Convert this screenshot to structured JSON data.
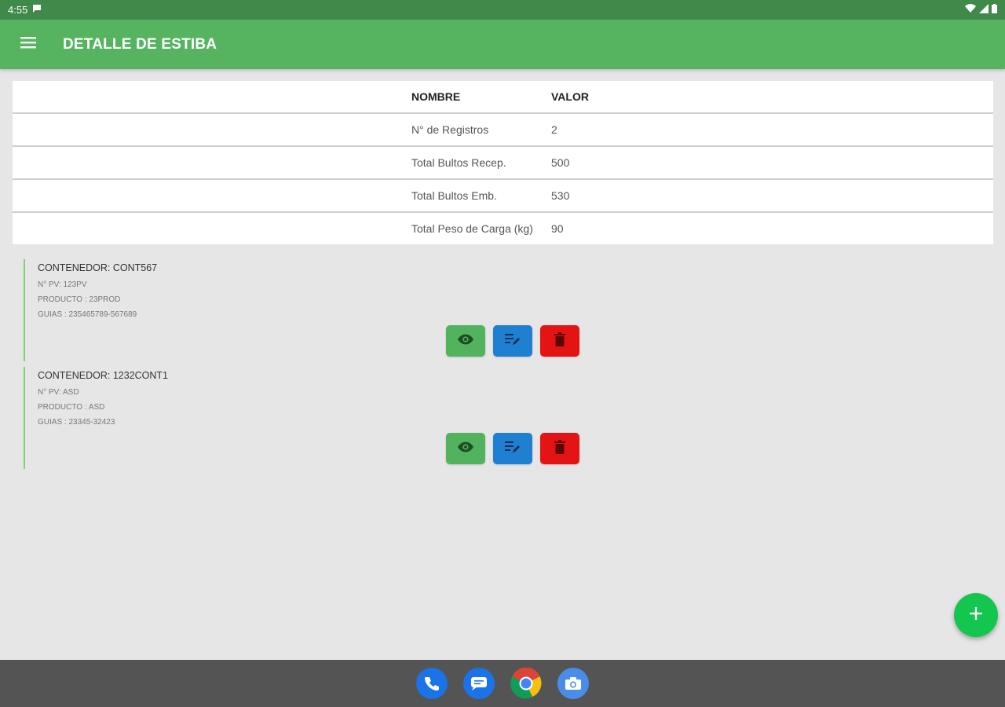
{
  "status_bar": {
    "time": "4:55"
  },
  "app_bar": {
    "title": "DETALLE DE ESTIBA"
  },
  "summary": {
    "header": {
      "name": "NOMBRE",
      "value": "VALOR"
    },
    "rows": [
      {
        "name": "N° de Registros",
        "value": "2"
      },
      {
        "name": "Total Bultos Recep.",
        "value": "500"
      },
      {
        "name": "Total Bultos Emb.",
        "value": "530"
      },
      {
        "name": "Total Peso de Carga (kg)",
        "value": "90"
      }
    ]
  },
  "records": [
    {
      "title": "CONTENEDOR: CONT567",
      "pv": "N° PV: 123PV",
      "producto": "PRODUCTO : 23PROD",
      "guias": "GUIAS : 235465789-567689"
    },
    {
      "title": "CONTENEDOR: 1232CONT1",
      "pv": "N° PV: ASD",
      "producto": "PRODUCTO : ASD",
      "guias": "GUIAS : 23345-32423"
    }
  ],
  "colors": {
    "status_bar": "#3f8a4a",
    "app_bar": "#56b461",
    "view_button": "#52b35f",
    "edit_button": "#1f7fd1",
    "delete_button": "#e41414",
    "fab": "#13c64e",
    "record_accent": "#7cd66b"
  },
  "icons": {
    "menu": "hamburger-menu-icon",
    "view": "eye-icon",
    "edit": "edit-note-icon",
    "delete": "trash-icon",
    "fab": "plus-icon",
    "dock": [
      "phone-icon",
      "messages-icon",
      "chrome-icon",
      "camera-icon"
    ]
  }
}
